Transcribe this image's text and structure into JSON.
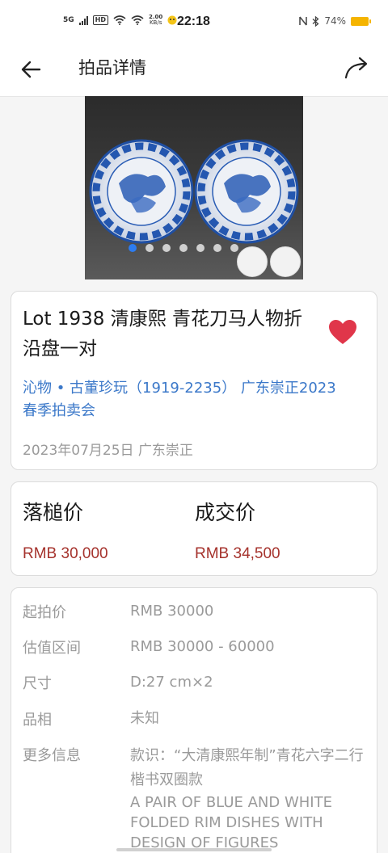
{
  "status_bar": {
    "network": "5G",
    "hd": "HD",
    "speed_value": "2.00",
    "speed_unit": "KB/s",
    "time": "22:18",
    "battery": "74%"
  },
  "header": {
    "title": "拍品详情",
    "back_icon": "arrow-left-icon",
    "share_icon": "share-arrow-icon"
  },
  "carousel": {
    "image_count": 7,
    "active_index": 0,
    "accent_color": "#2d7cf0"
  },
  "lot": {
    "title": "Lot 1938 清康熙  青花刀马人物折沿盘一对",
    "favorite_icon": "heart-icon",
    "favorite_color": "#e0364a",
    "auction": "沁物 • 古董珍玩（1919-2235） 广东崇正2023春季拍卖会",
    "date_location": "2023年07月25日 广东崇正"
  },
  "prices": {
    "hammer_label": "落槌价",
    "hammer_value": "RMB 30,000",
    "deal_label": "成交价",
    "deal_value": "RMB 34,500",
    "value_color": "#a5322c"
  },
  "details": {
    "rows": [
      {
        "label": "起拍价",
        "value": "RMB 30000"
      },
      {
        "label": "估值区间",
        "value": "RMB 30000 - 60000"
      },
      {
        "label": "尺寸",
        "value": "D:27 cm×2"
      },
      {
        "label": "品相",
        "value": "未知"
      },
      {
        "label": "更多信息",
        "value": "款识：“大清康熙年制”青花六字二行楷书双圈款",
        "value_en": "A PAIR OF BLUE AND WHITE FOLDED RIM DISHES WITH DESIGN OF FIGURES"
      }
    ]
  }
}
